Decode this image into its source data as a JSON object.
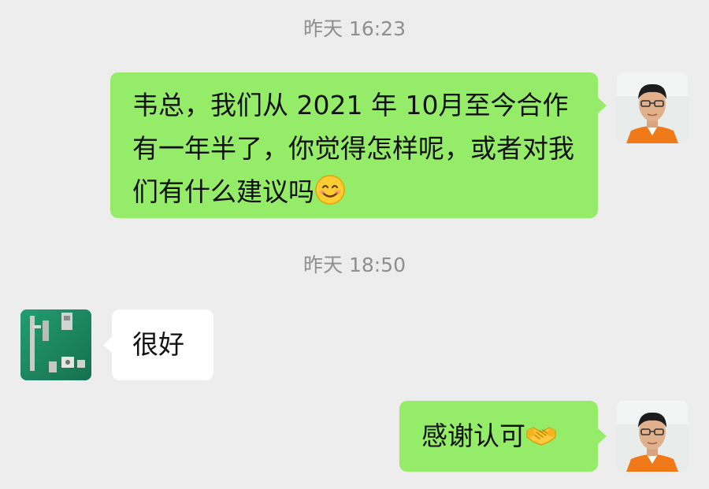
{
  "chat": {
    "messages": [
      {
        "timestamp": "昨天 16:23",
        "sender": "me",
        "text": "韦总，我们从 2021 年 10月至今合作有一年半了，你觉得怎样呢，或者对我们有什么建议吗",
        "emoji": "smiling-face-icon"
      },
      {
        "timestamp": "昨天 18:50",
        "sender": "contact",
        "text": "很好"
      },
      {
        "sender": "me",
        "text": "感谢认可",
        "emoji": "handshake-icon"
      }
    ]
  },
  "colors": {
    "background": "#ededed",
    "sent_bubble": "#95ec69",
    "received_bubble": "#ffffff",
    "timestamp_text": "#8f8f8f"
  }
}
